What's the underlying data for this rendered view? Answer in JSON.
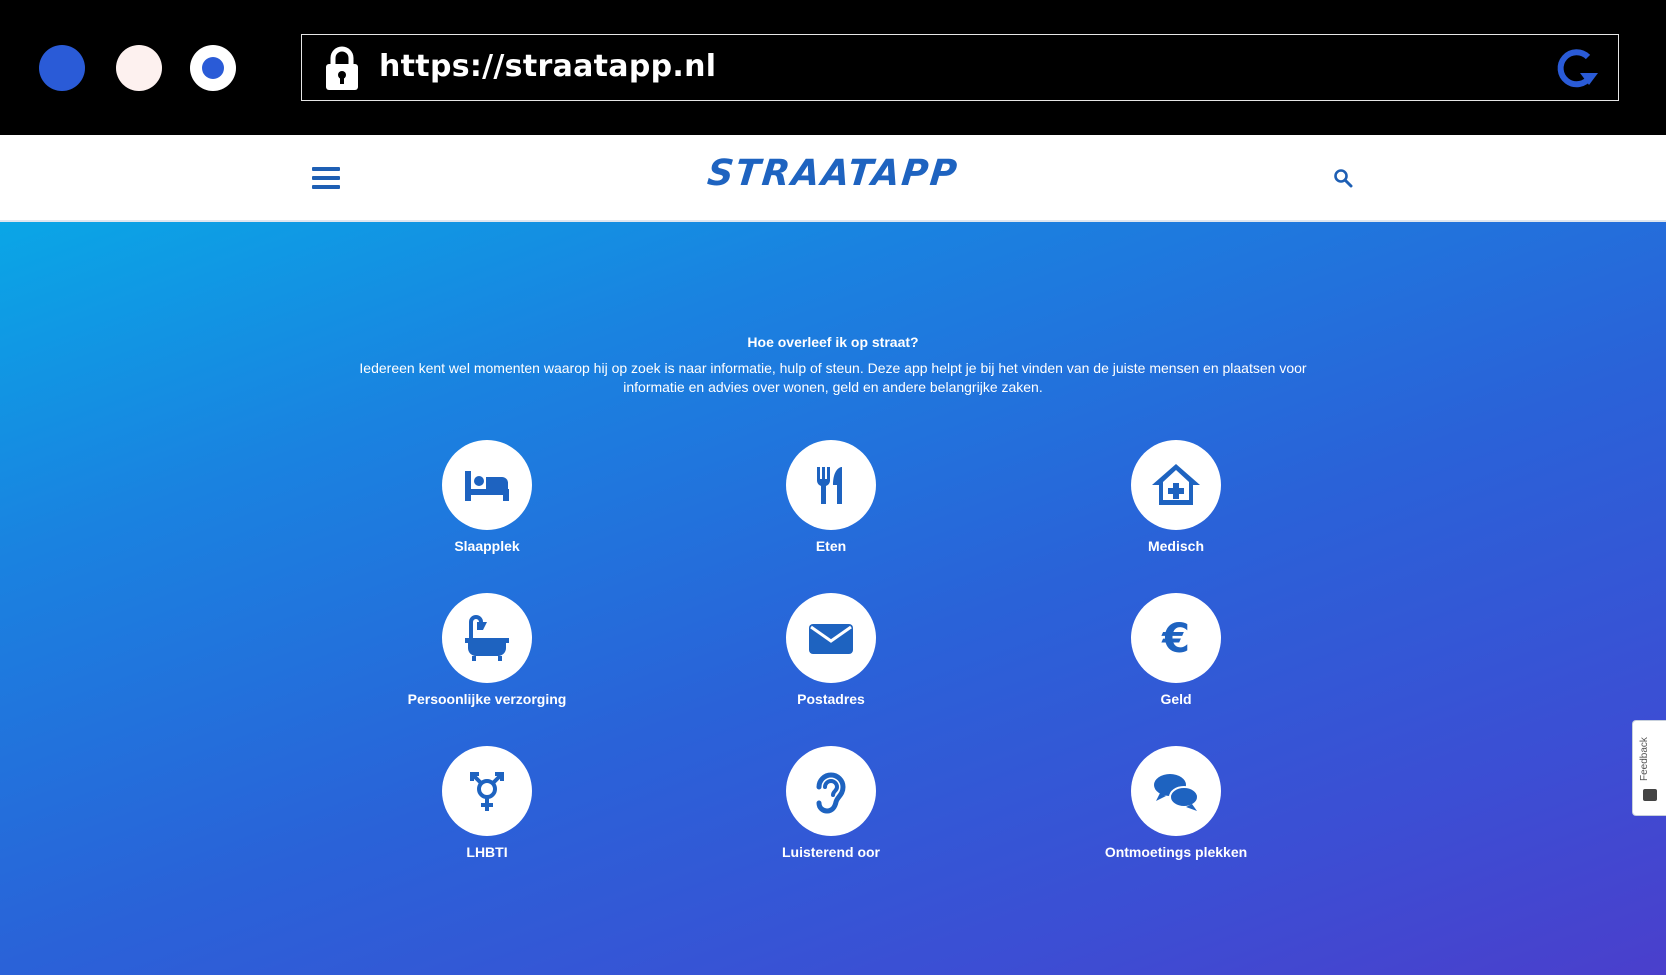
{
  "browser": {
    "url": "https://straatapp.nl",
    "window_controls": [
      "close",
      "minimize",
      "maximize"
    ],
    "colors": {
      "accent": "#2a5bd7",
      "bar": "#000000"
    },
    "icons": {
      "lock": "lock-icon",
      "reload": "reload-icon"
    }
  },
  "header": {
    "logo": "STRAATAPP",
    "menu_icon": "hamburger-menu-icon",
    "search_icon": "search-icon",
    "brand_color": "#1e63c0"
  },
  "intro": {
    "title": "Hoe overleef ik op straat?",
    "text": "Iedereen kent wel momenten waarop hij op zoek is naar informatie, hulp of steun. Deze app helpt je bij het vinden van de juiste mensen en plaatsen voor informatie en advies over wonen, geld en andere belangrijke zaken."
  },
  "categories": [
    {
      "label": "Slaapplek",
      "icon": "bed-icon"
    },
    {
      "label": "Eten",
      "icon": "cutlery-icon"
    },
    {
      "label": "Medisch",
      "icon": "medical-home-icon"
    },
    {
      "label": "Persoonlijke verzorging",
      "icon": "bathtub-icon"
    },
    {
      "label": "Postadres",
      "icon": "envelope-icon"
    },
    {
      "label": "Geld",
      "icon": "euro-icon"
    },
    {
      "label": "LHBTI",
      "icon": "transgender-icon"
    },
    {
      "label": "Luisterend oor",
      "icon": "ear-icon"
    },
    {
      "label": "Ontmoetings plekken",
      "icon": "chat-bubbles-icon"
    }
  ],
  "feedback": {
    "label": "Feedback",
    "icon": "feedback-icon"
  }
}
